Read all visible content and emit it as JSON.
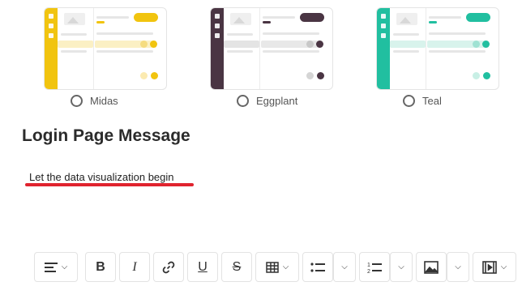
{
  "themes": [
    {
      "label": "Midas",
      "color": "#f1c40f",
      "tint": "#fbf0c4"
    },
    {
      "label": "Eggplant",
      "color": "#4a3543",
      "tint": "#e4e4e4"
    },
    {
      "label": "Teal",
      "color": "#21bfa0",
      "tint": "#d8f3ec"
    }
  ],
  "section": {
    "title": "Login Page Message",
    "message": "Let the data visualization begin"
  },
  "toolbar": {
    "align": "align-left-icon",
    "bold": "B",
    "italic": "I",
    "link": "link-icon",
    "underline": "U",
    "strike": "S",
    "table": "table-icon",
    "bullets": "bullet-list-icon",
    "numbers": "numbered-list-icon",
    "image": "image-icon",
    "video": "video-icon"
  }
}
